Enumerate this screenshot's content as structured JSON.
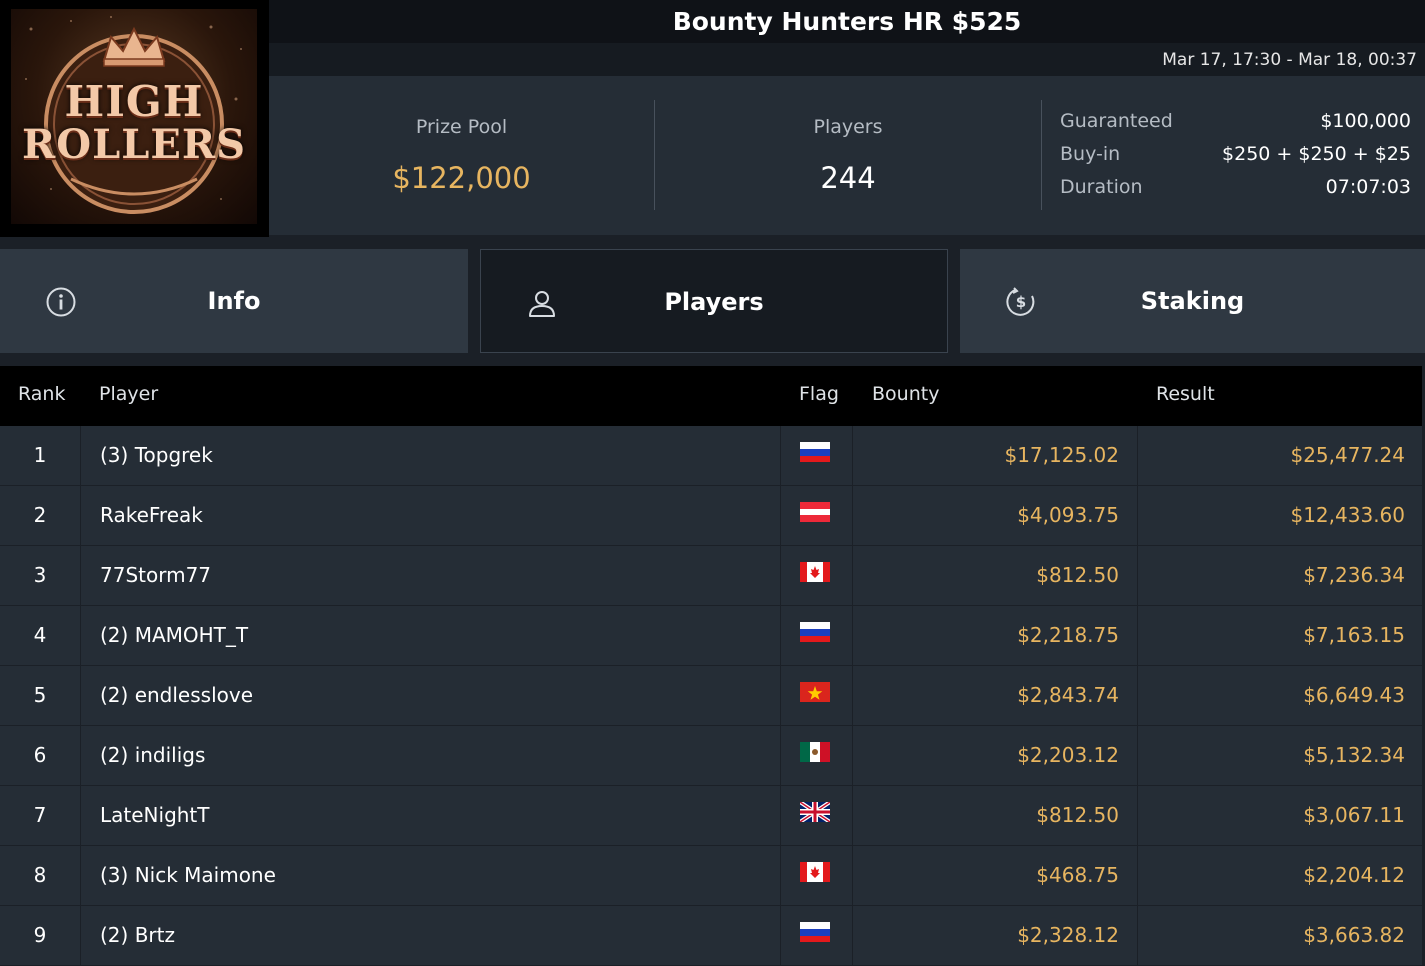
{
  "logo": {
    "line1": "HIGH",
    "line2": "ROLLERS"
  },
  "tournament": {
    "title": "Bounty Hunters HR $525",
    "dates": "Mar 17, 17:30 - Mar 18, 00:37"
  },
  "stats": {
    "prize_pool_label": "Prize Pool",
    "prize_pool_value": "$122,000",
    "players_label": "Players",
    "players_value": "244",
    "guaranteed_label": "Guaranteed",
    "guaranteed_value": "$100,000",
    "buyin_label": "Buy-in",
    "buyin_value": "$250 + $250 + $25",
    "duration_label": "Duration",
    "duration_value": "07:07:03"
  },
  "tabs": [
    {
      "label": "Info",
      "icon": "info-icon",
      "active": false
    },
    {
      "label": "Players",
      "icon": "user-icon",
      "active": true
    },
    {
      "label": "Staking",
      "icon": "dollar-coin-icon",
      "active": false
    }
  ],
  "table": {
    "headers": {
      "rank": "Rank",
      "player": "Player",
      "flag": "Flag",
      "bounty": "Bounty",
      "result": "Result"
    },
    "rows": [
      {
        "rank": "1",
        "player": "(3) Topgrek",
        "flag": "russia",
        "bounty": "$17,125.02",
        "result": "$25,477.24"
      },
      {
        "rank": "2",
        "player": "RakeFreak",
        "flag": "austria",
        "bounty": "$4,093.75",
        "result": "$12,433.60"
      },
      {
        "rank": "3",
        "player": "77Storm77",
        "flag": "canada",
        "bounty": "$812.50",
        "result": "$7,236.34"
      },
      {
        "rank": "4",
        "player": "(2) MAMOHT_T",
        "flag": "russia",
        "bounty": "$2,218.75",
        "result": "$7,163.15"
      },
      {
        "rank": "5",
        "player": "(2) endlesslove",
        "flag": "vietnam",
        "bounty": "$2,843.74",
        "result": "$6,649.43"
      },
      {
        "rank": "6",
        "player": "(2) indiligs",
        "flag": "mexico",
        "bounty": "$2,203.12",
        "result": "$5,132.34"
      },
      {
        "rank": "7",
        "player": "LateNightT",
        "flag": "united-kingdom",
        "bounty": "$812.50",
        "result": "$3,067.11"
      },
      {
        "rank": "8",
        "player": "(3) Nick Maimone",
        "flag": "canada",
        "bounty": "$468.75",
        "result": "$2,204.12"
      },
      {
        "rank": "9",
        "player": "(2) Brtz",
        "flag": "russia",
        "bounty": "$2,328.12",
        "result": "$3,663.82"
      }
    ]
  },
  "colors": {
    "accent_gold": "#e7b560",
    "background": "#1b2027",
    "row_bg": "#252d36",
    "header_bg": "#000000"
  }
}
